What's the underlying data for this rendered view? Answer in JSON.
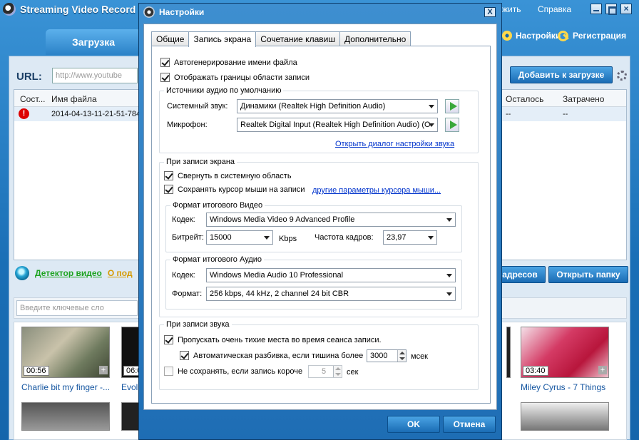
{
  "app": {
    "title": "Streaming Video Record",
    "menu_help_partial": "жить",
    "menu_help": "Справка",
    "tab_download": "Загрузка",
    "settings_link": "Настройки",
    "register_link": "Регистрация",
    "url_label": "URL:",
    "url_placeholder": "http://www.youtube",
    "add_button": "Добавить к загрузке",
    "columns": {
      "status": "Сост...",
      "filename": "Имя файла",
      "remaining": "Осталось",
      "spent": "Затрачено"
    },
    "row": {
      "filename": "2014-04-13-11-21-51-784",
      "remaining": "--",
      "spent": "--"
    },
    "detector": "Детектор видео",
    "detector_more": "О под",
    "addresses_button": "адресов",
    "open_folder_button": "Открыть папку",
    "keywords_placeholder": "Введите ключевые сло",
    "thumbnails": [
      {
        "duration": "00:56",
        "caption": "Charlie bit my finger -..."
      },
      {
        "duration": "06:0",
        "caption": "Evolu"
      },
      {
        "duration": "03:40",
        "caption": "Miley Cyrus - 7 Things"
      }
    ],
    "thumb_plus": "+"
  },
  "dialog": {
    "title": "Настройки",
    "close": "X",
    "tabs": [
      "Общие",
      "Запись экрана",
      "Сочетание клавиш",
      "Дополнительно"
    ],
    "auto_filename": {
      "label": "Автогенерирование имени файла",
      "checked": true
    },
    "show_bounds": {
      "label": "Отображать границы области записи",
      "checked": true
    },
    "audio_sources": {
      "title": "Источники аудио по умолчанию",
      "system_label": "Системный звук:",
      "system_value": "Динамики (Realtek High Definition Audio)",
      "mic_label": "Микрофон:",
      "mic_value": "Realtek Digital Input (Realtek High Definition Audio) (O",
      "sound_dialog_link": "Открыть диалог настройки звука"
    },
    "screen_rec": {
      "title": "При записи экрана",
      "minimize": {
        "label": "Свернуть в системную область",
        "checked": true
      },
      "keep_cursor": {
        "label": "Сохранять курсор мыши на записи",
        "checked": true
      },
      "cursor_link": "другие параметры курсора мыши...",
      "video_format": {
        "title": "Формат итогового Видео",
        "codec_label": "Кодек:",
        "codec_value": "Windows Media Video 9 Advanced Profile",
        "bitrate_label": "Битрейт:",
        "bitrate_value": "15000",
        "bitrate_unit": "Kbps",
        "fps_label": "Частота кадров:",
        "fps_value": "23,97"
      },
      "audio_format": {
        "title": "Формат итогового Аудио",
        "codec_label": "Кодек:",
        "codec_value": "Windows Media Audio 10 Professional",
        "format_label": "Формат:",
        "format_value": "256 kbps, 44 kHz, 2 channel 24 bit CBR"
      }
    },
    "sound_rec": {
      "title": "При записи звука",
      "skip_silence": {
        "label": "Пропускать очень тихие места во время сеанса записи.",
        "checked": true
      },
      "auto_split": {
        "label": "Автоматическая разбивка, если тишина более",
        "checked": true
      },
      "auto_split_value": "3000",
      "auto_split_unit": "мсек",
      "dont_save": {
        "label": "Не сохранять, если запись короче",
        "checked": false
      },
      "dont_save_value": "5",
      "dont_save_unit": "сек"
    },
    "ok_button": "OK",
    "cancel_button": "Отмена"
  }
}
